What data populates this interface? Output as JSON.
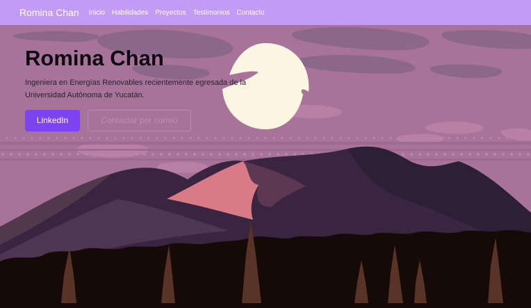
{
  "navbar": {
    "brand": "Romina Chan",
    "links": [
      "Inicio",
      "Habilidades",
      "Proyectos",
      "Testimonios",
      "Contacto"
    ]
  },
  "hero": {
    "title": "Romina Chan",
    "subtitle": "Ingeniera en Energías Renovables recientemente egresada de la Universidad Autónoma de Yucatán.",
    "primary_button": "LinkedIn",
    "secondary_button": "Contactar por correo"
  },
  "colors": {
    "navbar": "#c39bf5",
    "primary": "#7c44f0",
    "sky": "#a77399",
    "moon": "#fcf5e1",
    "mountain_dark": "#2c1f36",
    "mountain_pink": "#d87b86",
    "forest": "#160a08"
  }
}
